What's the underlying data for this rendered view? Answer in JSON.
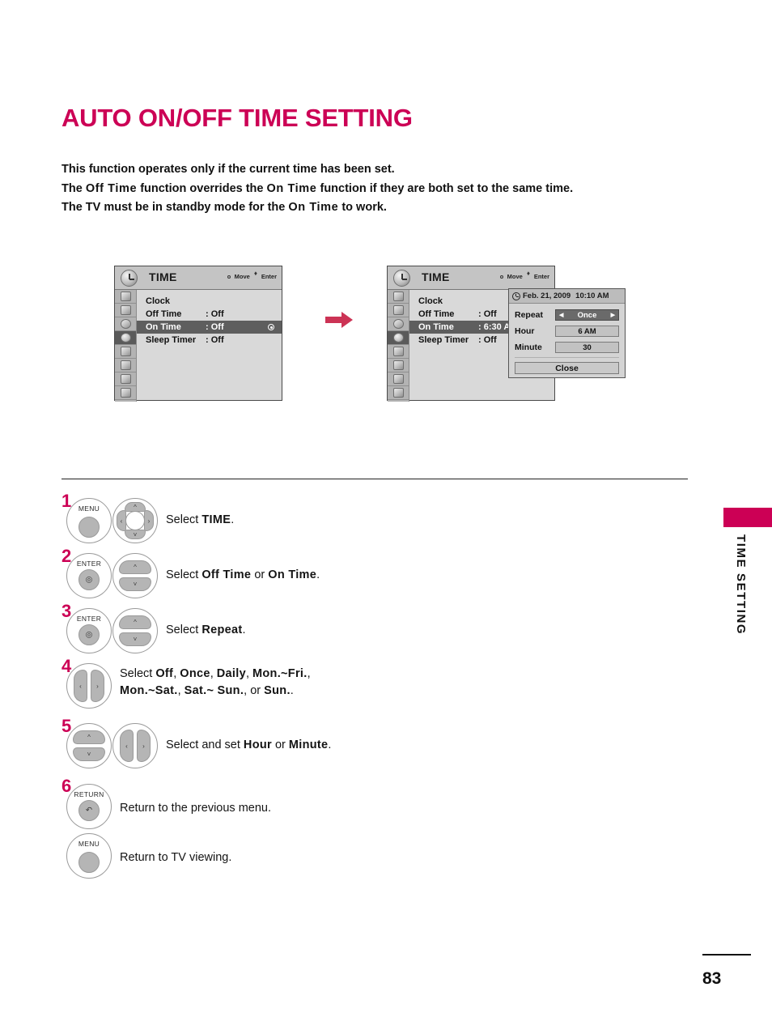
{
  "page": {
    "title": "AUTO ON/OFF TIME SETTING",
    "page_number": "83",
    "side_tab_label": "TIME SETTING",
    "accent_color": "#cc0055"
  },
  "intro": {
    "line1": "This function operates only if the current time has been set.",
    "line2_a": "The ",
    "line2_b": "Off Time",
    "line2_c": " function overrides the ",
    "line2_d": "On Time",
    "line2_e": " function if they are both set to the same time.",
    "line3_a": "The TV must be in standby mode for the ",
    "line3_b": "On Time",
    "line3_c": " to work."
  },
  "osd_before": {
    "title": "TIME",
    "hint_move": "Move",
    "hint_enter": "Enter",
    "rows": [
      {
        "label": "Clock",
        "value": ""
      },
      {
        "label": "Off Time",
        "value": ": Off"
      },
      {
        "label": "On Time",
        "value": ": Off"
      },
      {
        "label": "Sleep Timer",
        "value": ": Off"
      }
    ]
  },
  "osd_after": {
    "title": "TIME",
    "hint_move": "Move",
    "hint_enter": "Enter",
    "rows": [
      {
        "label": "Clock",
        "value": ""
      },
      {
        "label": "Off Time",
        "value": ": Off"
      },
      {
        "label": "On Time",
        "value": ": 6:30 AM"
      },
      {
        "label": "Sleep Timer",
        "value": ": Off"
      }
    ]
  },
  "popup": {
    "date": "Feb. 21, 2009",
    "time": "10:10 AM",
    "repeat_label": "Repeat",
    "repeat_value": "Once",
    "arrow_left": "◀",
    "arrow_right": "▶",
    "hour_label": "Hour",
    "hour_value": "6 AM",
    "minute_label": "Minute",
    "minute_value": "30",
    "close_label": "Close"
  },
  "steps": [
    {
      "number": "1",
      "button_label": "MENU",
      "text_prefix": "Select ",
      "text_bold": "TIME",
      "text_suffix": "."
    },
    {
      "number": "2",
      "button_label": "ENTER",
      "text_prefix": "Select ",
      "text_bold": "Off Time",
      "text_mid": " or ",
      "text_bold2": "On Time",
      "text_suffix": "."
    },
    {
      "number": "3",
      "button_label": "ENTER",
      "text_prefix": "Select ",
      "text_bold": "Repeat",
      "text_suffix": "."
    },
    {
      "number": "4",
      "line1_prefix": "Select ",
      "line1_b1": "Off",
      "line1_s1": ", ",
      "line1_b2": "Once",
      "line1_s2": ", ",
      "line1_b3": "Daily",
      "line1_s3": ", ",
      "line1_b4": "Mon.~Fri.",
      "line1_s4": ",",
      "line2_b1": "Mon.~Sat.",
      "line2_s1": ", ",
      "line2_b2": "Sat.~ Sun.",
      "line2_s2": ", or ",
      "line2_b3": "Sun.",
      "line2_s3": "."
    },
    {
      "number": "5",
      "text_prefix": "Select and set ",
      "text_bold": "Hour",
      "text_mid": " or ",
      "text_bold2": "Minute",
      "text_suffix": "."
    },
    {
      "number": "6",
      "button_label": "RETURN",
      "text": "Return to the previous menu."
    },
    {
      "button_label": "MENU",
      "text": "Return to TV viewing."
    }
  ]
}
